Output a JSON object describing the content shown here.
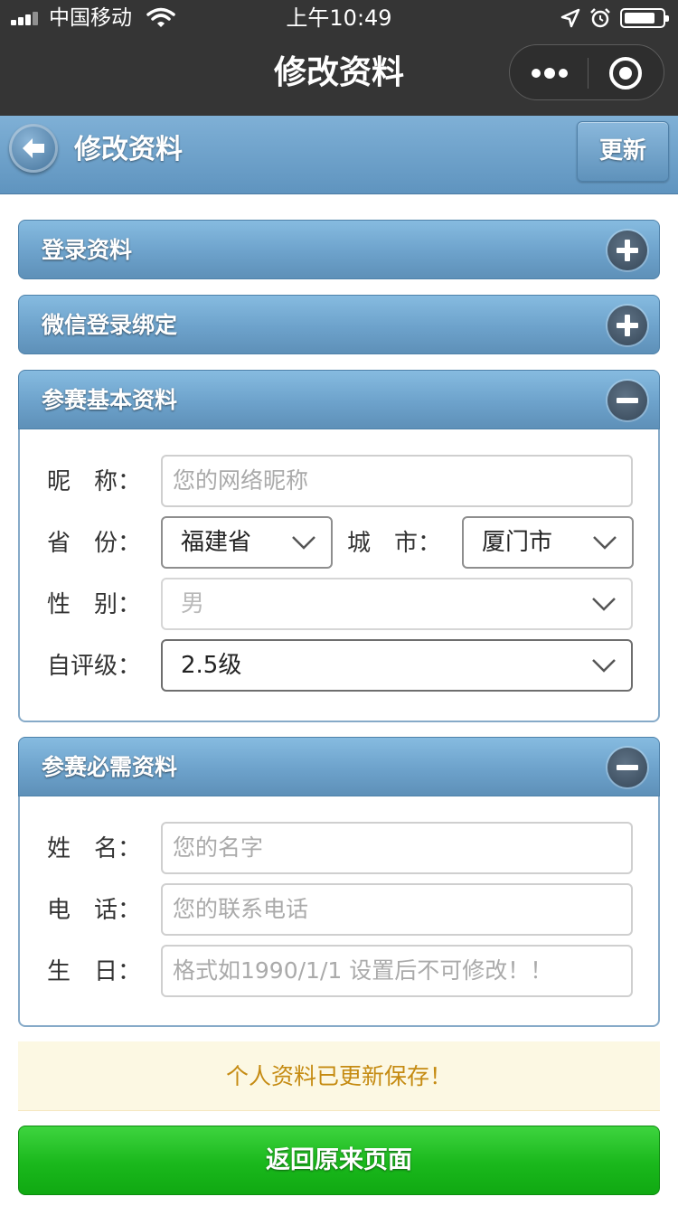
{
  "status_bar": {
    "carrier": "中国移动",
    "time": "上午10:49"
  },
  "nav": {
    "title": "修改资料"
  },
  "header": {
    "title": "修改资料",
    "update_label": "更新"
  },
  "sections": {
    "login": {
      "title": "登录资料",
      "expanded": false
    },
    "wechat": {
      "title": "微信登录绑定",
      "expanded": false
    },
    "basic": {
      "title": "参赛基本资料",
      "expanded": true,
      "nickname": {
        "label": "昵　称：",
        "placeholder": "您的网络昵称"
      },
      "province": {
        "label": "省　份：",
        "value": "福建省"
      },
      "city": {
        "label": "城　市：",
        "value": "厦门市"
      },
      "gender": {
        "label": "性　别：",
        "value": "男"
      },
      "level": {
        "label": "自评级：",
        "value": "2.5级"
      }
    },
    "required": {
      "title": "参赛必需资料",
      "expanded": true,
      "name": {
        "label": "姓　名：",
        "placeholder": "您的名字"
      },
      "phone": {
        "label": "电　话：",
        "placeholder": "您的联系电话"
      },
      "birthday": {
        "label": "生　日：",
        "placeholder": "格式如1990/1/1 设置后不可修改！！"
      }
    }
  },
  "alert": {
    "message": "个人资料已更新保存！"
  },
  "footer": {
    "return_label": "返回原来页面"
  },
  "colors": {
    "header_blue": "#6b9dc6",
    "alert_text": "#c58b12",
    "button_green": "#1ab81c"
  }
}
